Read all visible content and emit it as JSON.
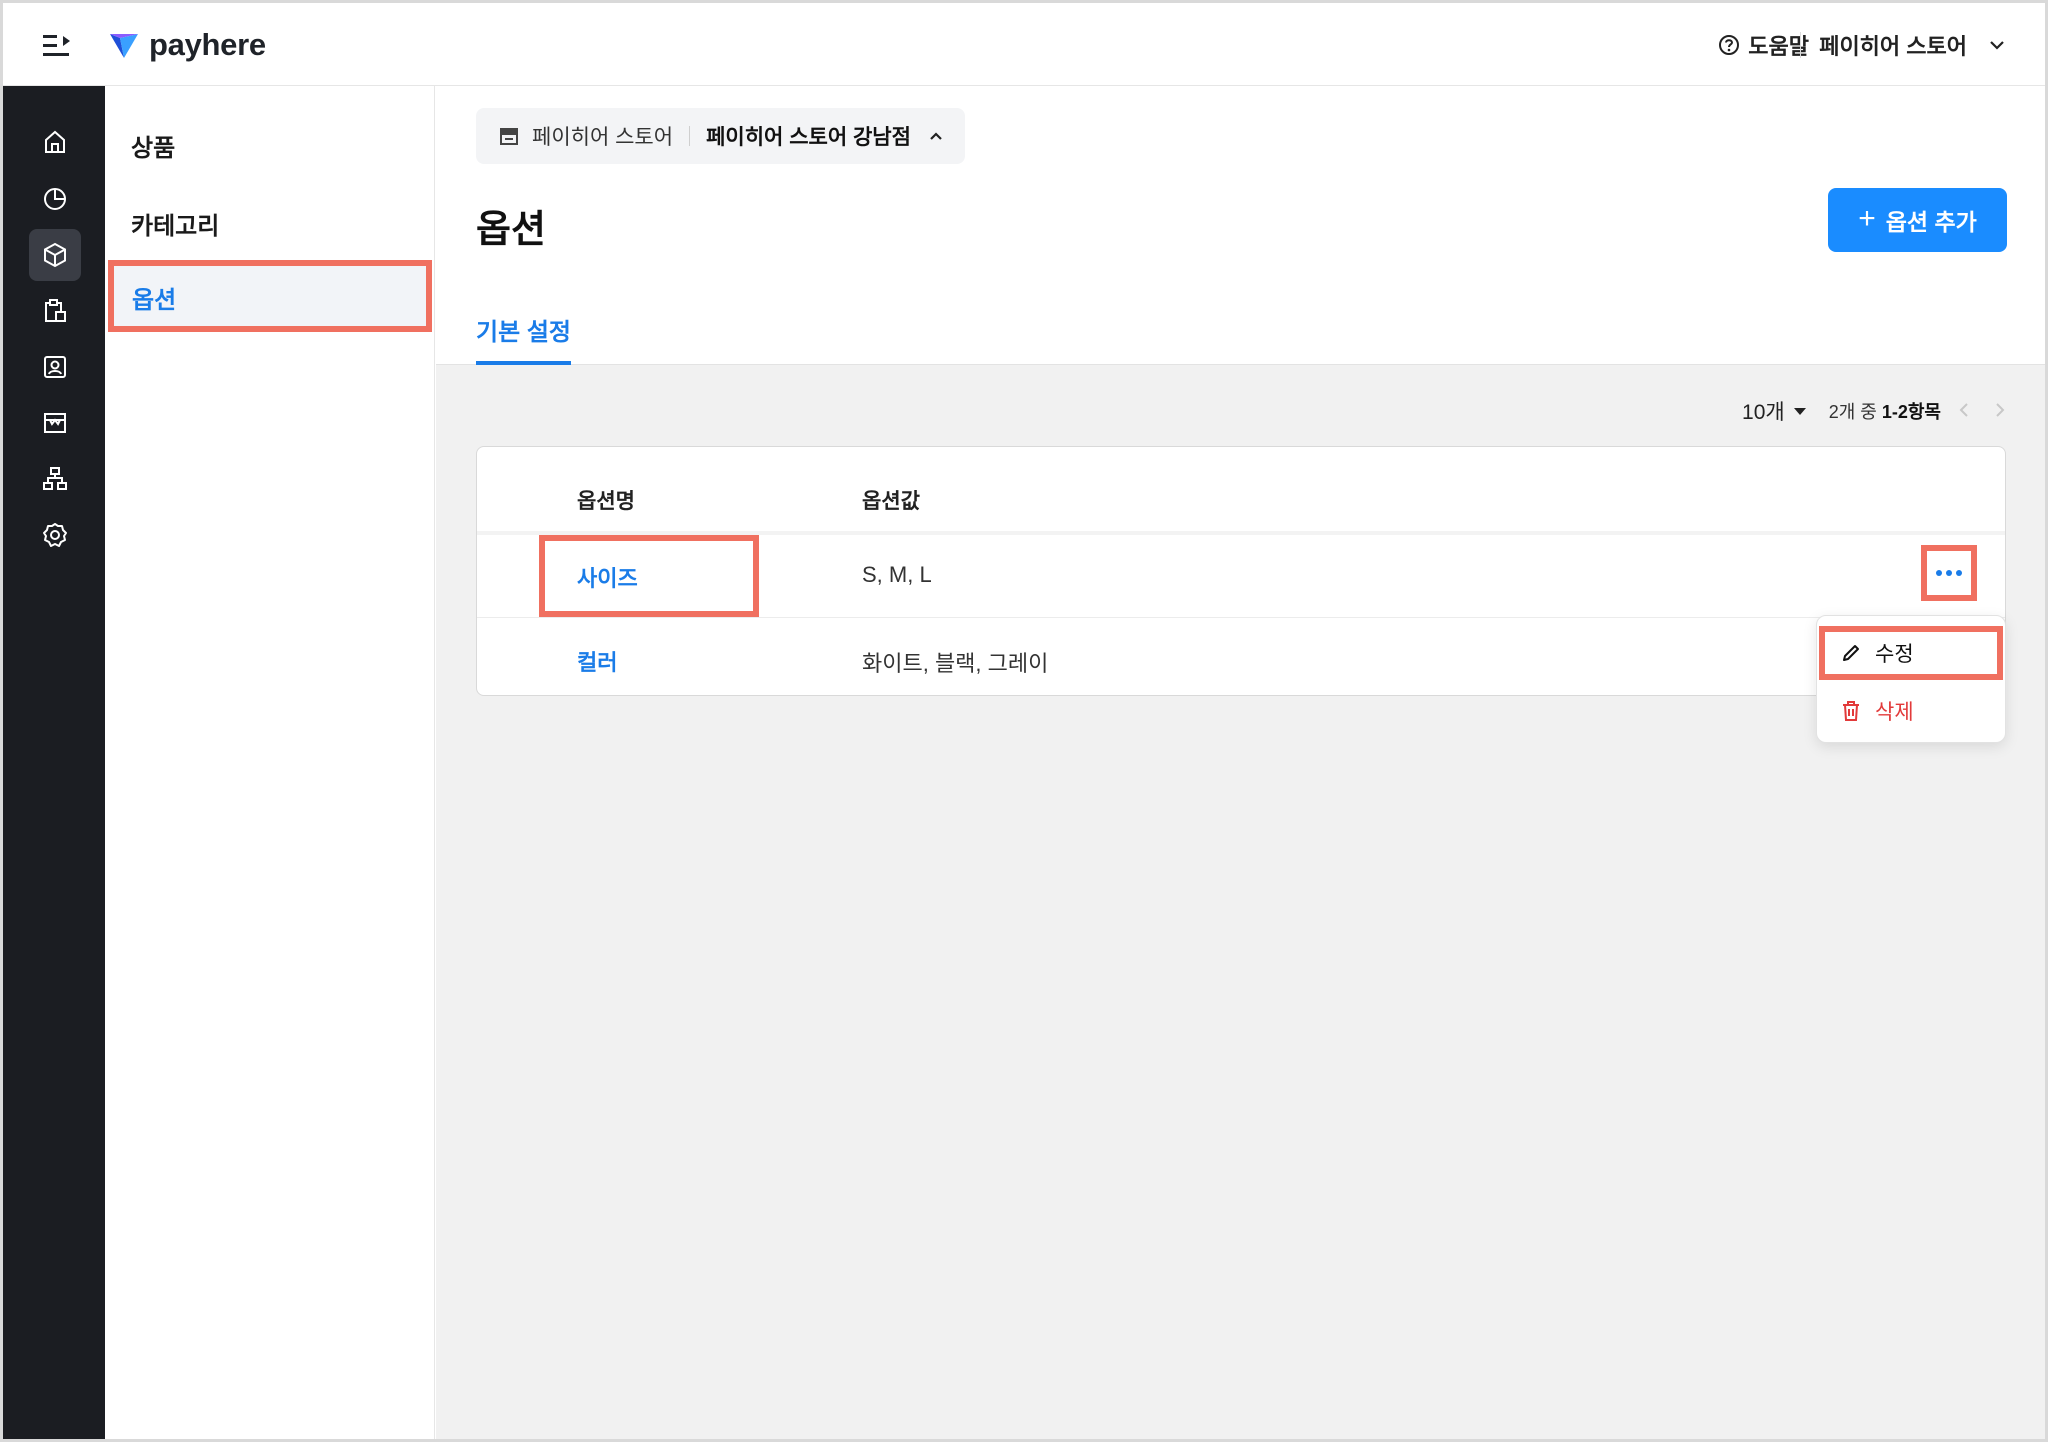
{
  "app": {
    "logo_text": "payhere"
  },
  "topbar": {
    "help_label": "도움말",
    "store_label": "페이히어 스토어"
  },
  "subnav": {
    "items": [
      {
        "label": "상품"
      },
      {
        "label": "카테고리"
      },
      {
        "label": "옵션"
      }
    ]
  },
  "breadcrumb": {
    "store": "페이히어 스토어",
    "branch": "페이히어 스토어 강남점"
  },
  "page": {
    "title": "옵션",
    "add_button": "옵션 추가",
    "tab": "기본 설정"
  },
  "pager": {
    "page_size": "10개",
    "total_prefix": "2개 중 ",
    "range": "1-2항목"
  },
  "table": {
    "headers": {
      "name": "옵션명",
      "value": "옵션값"
    },
    "rows": [
      {
        "name": "사이즈",
        "value": "S, M, L"
      },
      {
        "name": "컬러",
        "value": "화이트, 블랙, 그레이"
      }
    ]
  },
  "menu": {
    "edit": "수정",
    "delete": "삭제"
  },
  "colors": {
    "accent": "#1a8cff",
    "highlight": "#f07060",
    "danger": "#e23a3a",
    "rail": "#1b1d22"
  }
}
